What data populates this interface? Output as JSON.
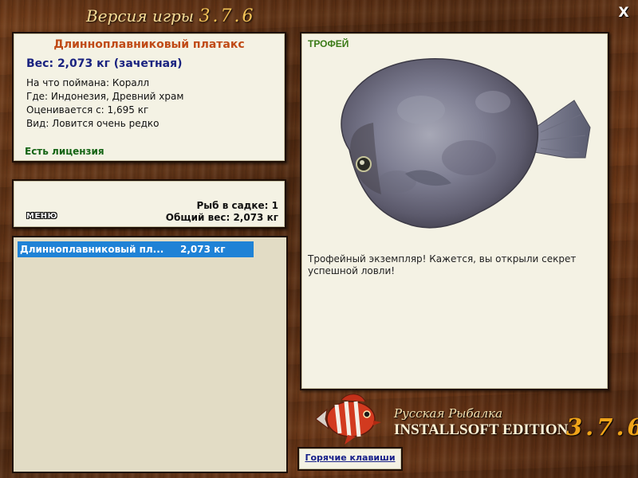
{
  "header": {
    "version_title": "Версия игры",
    "version_number": "3.7.6",
    "close_label": "X"
  },
  "fish_info": {
    "name": "Длинноплавниковый платакс",
    "weight": "Вес: 2,073 кг (зачетная)",
    "caught_on": "На что поймана: Коралл",
    "location": "Где: Индонезия, Древний храм",
    "rated_from": "Оценивается с: 1,695 кг",
    "kind": "Вид: Ловится очень редко",
    "license": "Есть лицензия"
  },
  "keepnet": {
    "fish_count": "Рыб в садке: 1",
    "total_weight": "Общий вес: 2,073 кг",
    "menu_label": "МЕНЮ"
  },
  "fish_list": [
    {
      "name": "Длинноплавниковый пл...",
      "weight": "2,073 кг",
      "selected": true
    }
  ],
  "trophy": {
    "tag": "ТРОФЕЙ",
    "description": "Трофейный экземпляр! Кажется, вы открыли секрет успешной ловли!",
    "image_icon": "platax-fish-image"
  },
  "logo": {
    "game_name": "Русская Рыбалка",
    "edition": "INSTALLSOFT EDITION",
    "version": "3.7.6",
    "icon": "red-white-fish-logo"
  },
  "footer": {
    "hotkeys_label": "Горячие клавиши"
  },
  "colors": {
    "wood": "#5a2f14",
    "panel": "#f4f2e4",
    "fish_name": "#c04a16",
    "weight_text": "#1a2380",
    "license_text": "#146414",
    "selection": "#1f82d6",
    "trophy_tag": "#3a7a16",
    "version_accent": "#f0a419"
  }
}
